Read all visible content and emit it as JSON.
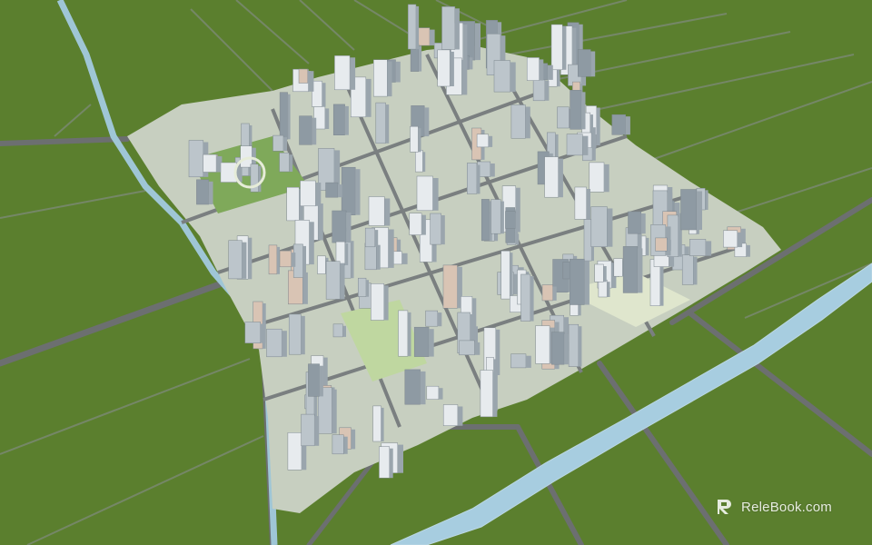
{
  "image": {
    "description_tags": [
      "aerial-3d-city-model",
      "green-field-ground",
      "river",
      "road-grid",
      "high-rise-towers"
    ],
    "palette": {
      "grass": "#5b7f2e",
      "grass_alt": "#628734",
      "road": "#6c6f70",
      "road_edge": "#8d9190",
      "plaza": "#c9d6a8",
      "park": "#7fa95a",
      "river": "#9fc6d6",
      "tower_light": "#e7ebee",
      "tower_mid": "#bcc5cb",
      "tower_dark": "#8e9aa3",
      "tower_warm": "#d9c4b4"
    }
  },
  "watermark": {
    "brand": "ReleBook.com",
    "icon": "relebook-logo-icon"
  }
}
